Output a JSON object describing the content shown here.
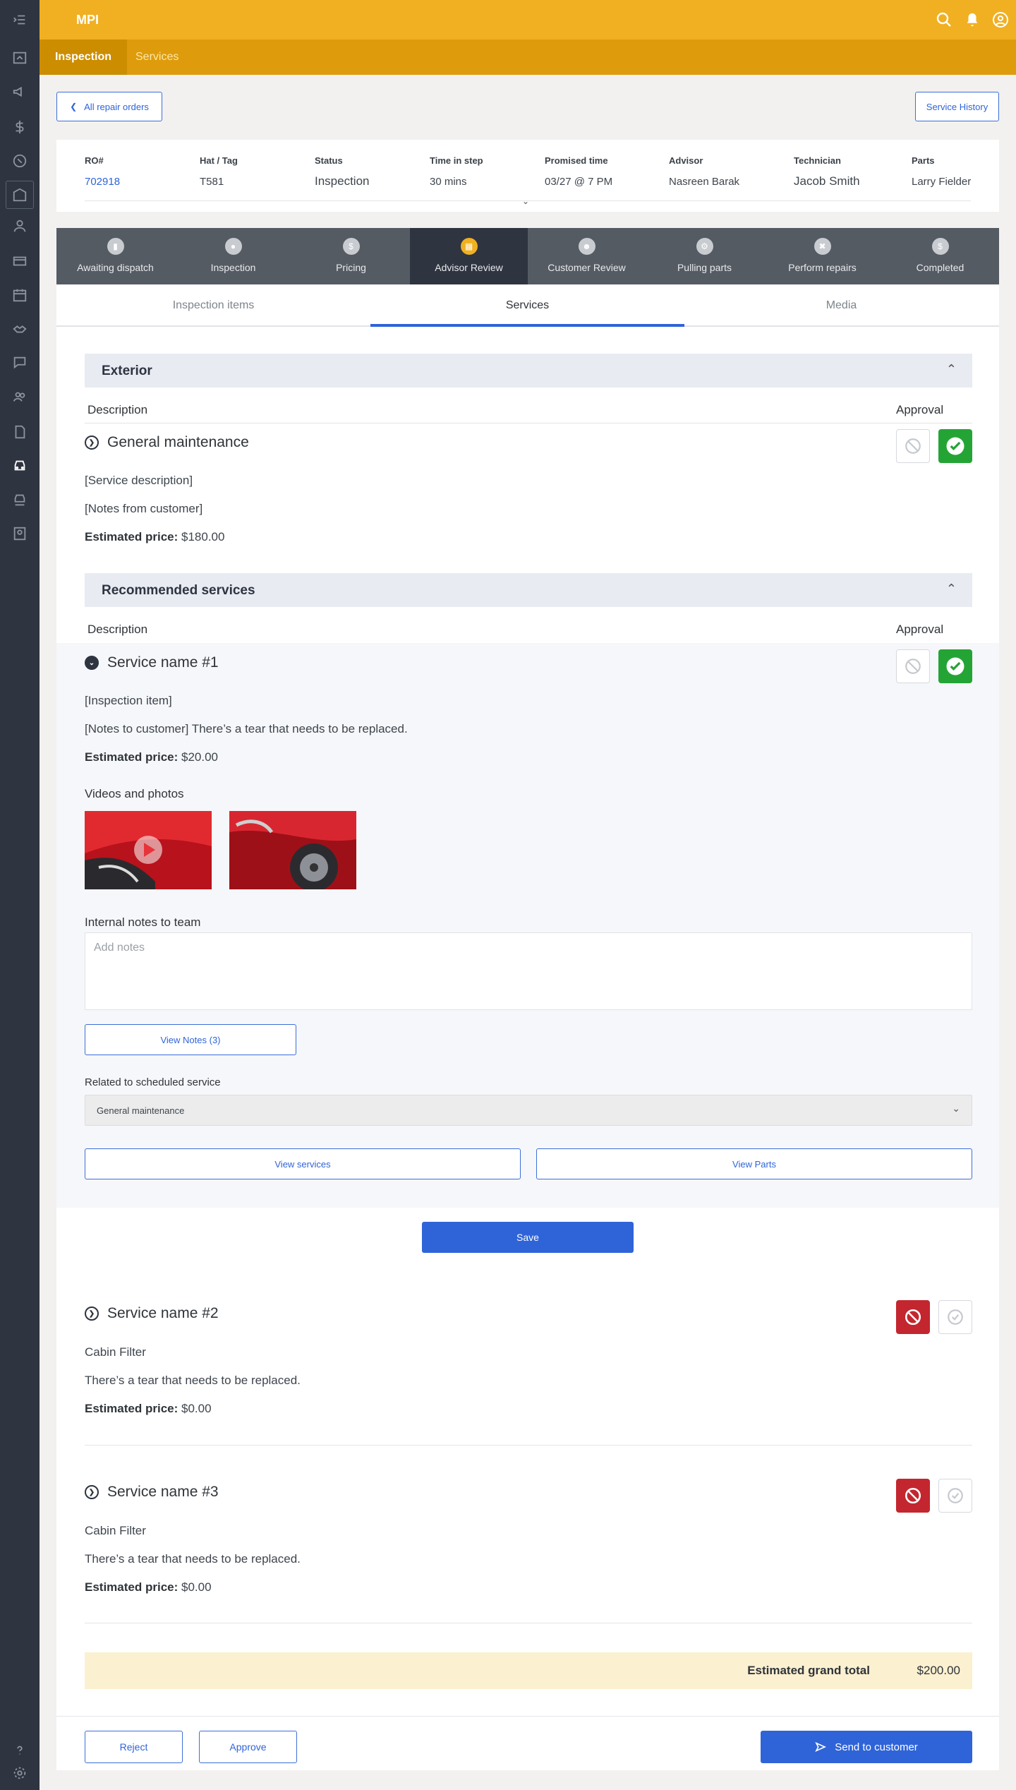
{
  "app": {
    "title": "MPI"
  },
  "subnav": {
    "active": "Inspection",
    "other": "Services"
  },
  "nav": {
    "back_label": "All repair orders",
    "history_label": "Service History"
  },
  "order": {
    "ro_label": "RO#",
    "ro_value": "702918",
    "tag_label": "Hat / Tag",
    "tag_value": "T581",
    "status_label": "Status",
    "status_value": "Inspection",
    "time_label": "Time in step",
    "time_value": "30 mins",
    "promised_label": "Promised time",
    "promised_value": "03/27 @ 7 PM",
    "advisor_label": "Advisor",
    "advisor_value": "Nasreen Barak",
    "tech_label": "Technician",
    "tech_value": "Jacob Smith",
    "parts_label": "Parts",
    "parts_value": "Larry Fielder"
  },
  "steps": [
    "Awaiting dispatch",
    "Inspection",
    "Pricing",
    "Advisor Review",
    "Customer Review",
    "Pulling parts",
    "Perform repairs",
    "Completed"
  ],
  "tabs": {
    "inspection": "Inspection items",
    "services": "Services",
    "media": "Media"
  },
  "exterior": {
    "title": "Exterior",
    "desc_header": "Description",
    "approval_header": "Approval",
    "service_name": "General maintenance",
    "service_desc": "[Service description]",
    "customer_notes": "[Notes from customer]",
    "price_label": "Estimated price:",
    "price": "$180.00"
  },
  "recommended": {
    "title": "Recommended services",
    "desc_header": "Description",
    "approval_header": "Approval",
    "svc1": {
      "name": "Service name #1",
      "item": "[Inspection item]",
      "notes": "[Notes to customer] There’s a tear that needs to be replaced.",
      "price_label": "Estimated price:",
      "price": "$20.00",
      "media_label": "Videos and photos",
      "internal_label": "Internal notes to team",
      "notes_placeholder": "Add notes",
      "view_notes": "View Notes (3)",
      "related_label": "Related to scheduled service",
      "related_value": "General maintenance",
      "view_services": "View services",
      "view_parts": "View Parts",
      "save": "Save"
    },
    "svc2": {
      "name": "Service name #2",
      "item": "Cabin Filter",
      "notes": "There’s a tear that needs to be replaced.",
      "price_label": "Estimated price:",
      "price": "$0.00"
    },
    "svc3": {
      "name": "Service name #3",
      "item": "Cabin Filter",
      "notes": "There’s a tear that needs to be replaced.",
      "price_label": "Estimated price:",
      "price": "$0.00"
    }
  },
  "total": {
    "label": "Estimated grand total",
    "value": "$200.00"
  },
  "footer": {
    "reject": "Reject",
    "approve": "Approve",
    "send": "Send to customer"
  },
  "colors": {
    "accent": "#2f64d8",
    "brand": "#f0b022",
    "approve": "#25a436",
    "reject": "#c3262f"
  }
}
